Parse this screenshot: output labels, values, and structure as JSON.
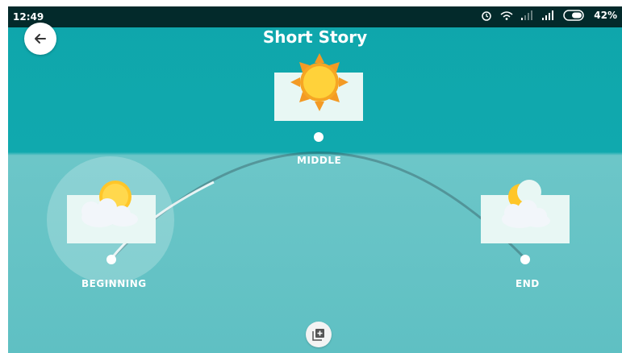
{
  "status_bar": {
    "time": "12:49",
    "battery_percent": "42%",
    "icons": [
      "alarm-icon",
      "wifi-icon",
      "signal-weak-icon",
      "signal-strong-icon",
      "battery-icon"
    ]
  },
  "header": {
    "title": "Short Story",
    "back_icon": "arrow-left-icon"
  },
  "story_points": [
    {
      "label": "BEGINNING",
      "icon": "sun-behind-cloud-icon",
      "selected": true
    },
    {
      "label": "MIDDLE",
      "icon": "sun-icon",
      "selected": false
    },
    {
      "label": "END",
      "icon": "moon-behind-cloud-icon",
      "selected": false
    }
  ],
  "footer": {
    "add_icon": "add-library-icon"
  },
  "colors": {
    "top_bg": "#10a9ae",
    "bottom_bg": "#5fc0c3",
    "card_bg": "#e8f7f4",
    "sun": "#ffc629",
    "sun_rays": "#f39a25"
  }
}
